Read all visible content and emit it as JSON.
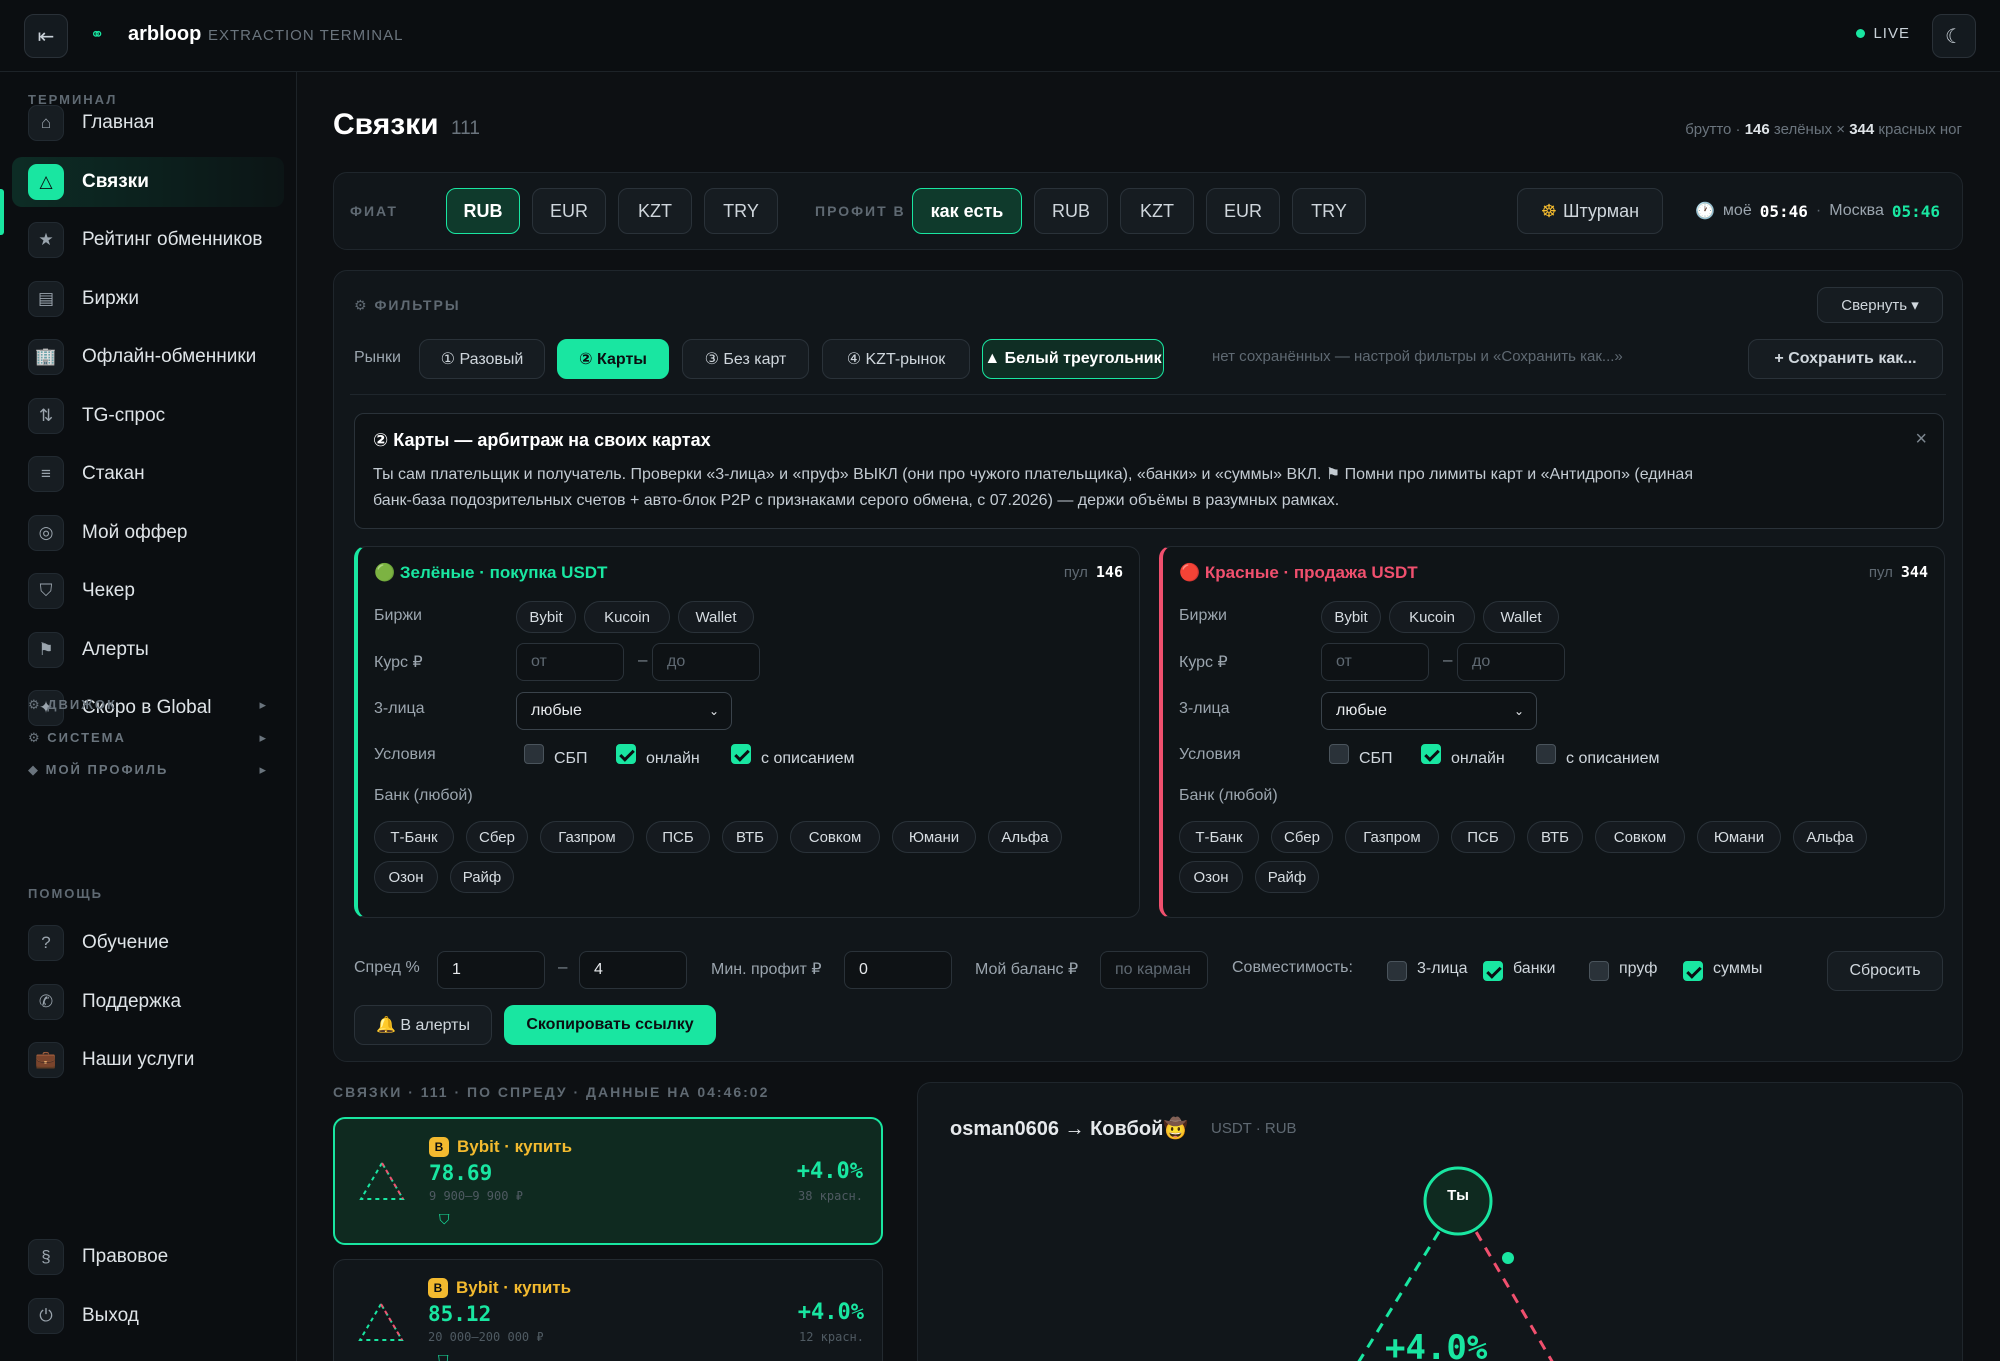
{
  "topbar": {
    "back_icon": "collapse-left-icon",
    "brand": "arbloop",
    "subtitle": "EXTRACTION TERMINAL",
    "live": "LIVE",
    "live_color": "#19e6a1",
    "theme_icon": "moon-icon"
  },
  "sidebar": {
    "section_terminal": "ТЕРМИНАЛ",
    "items": [
      {
        "label": "Главная",
        "icon": "home-icon",
        "glyph": "⌂"
      },
      {
        "label": "Связки",
        "icon": "triangle-icon",
        "glyph": "△"
      },
      {
        "label": "Рейтинг обменников",
        "icon": "star-icon",
        "glyph": "★"
      },
      {
        "label": "Биржи",
        "icon": "exchange-icon",
        "glyph": "▤"
      },
      {
        "label": "Офлайн-обменники",
        "icon": "building-icon",
        "glyph": "🏢"
      },
      {
        "label": "TG-спрос",
        "icon": "arrows-icon",
        "glyph": "⇅"
      },
      {
        "label": "Стакан",
        "icon": "orderbook-icon",
        "glyph": "≡"
      },
      {
        "label": "Мой оффер",
        "icon": "target-icon",
        "glyph": "◎"
      },
      {
        "label": "Чекер",
        "icon": "shield-icon",
        "glyph": "⛉"
      },
      {
        "label": "Алерты",
        "icon": "flag-icon",
        "glyph": "⚑"
      },
      {
        "label": "Скоро в Global",
        "icon": "sparkle-icon",
        "glyph": "✦"
      }
    ],
    "groups": [
      {
        "label": "⚙ ДВИЖОК",
        "arrow": "▸"
      },
      {
        "label": "⚙ СИСТЕМА",
        "arrow": "▸"
      },
      {
        "label": "◆ МОЙ ПРОФИЛЬ",
        "arrow": "▸"
      }
    ],
    "section_help": "ПОМОЩЬ",
    "help_items": [
      {
        "label": "Обучение",
        "icon": "question-icon",
        "glyph": "?"
      },
      {
        "label": "Поддержка",
        "icon": "phone-icon",
        "glyph": "✆"
      },
      {
        "label": "Наши услуги",
        "icon": "briefcase-icon",
        "glyph": "💼"
      }
    ],
    "bottom_items": [
      {
        "label": "Правовое",
        "icon": "section-icon",
        "glyph": "§"
      },
      {
        "label": "Выход",
        "icon": "power-icon",
        "glyph": "⏻"
      }
    ]
  },
  "page": {
    "title": "Связки",
    "count": "111",
    "stats_prefix": "брутто ·",
    "stats_green": "146",
    "stats_mid": "зелёных ×",
    "stats_red": "344",
    "stats_suffix": "красных ног"
  },
  "fiat_bar": {
    "fiat_label": "ФИАТ",
    "fiat_options": [
      "RUB",
      "EUR",
      "KZT",
      "TRY"
    ],
    "fiat_selected": "RUB",
    "profit_label": "ПРОФИТ В",
    "profit_options": [
      "как есть",
      "RUB",
      "KZT",
      "EUR",
      "TRY"
    ],
    "profit_selected": "как есть",
    "helmsman_label": "Штурман",
    "helmsman_icon": "helm-icon",
    "clock_icon": "clock-icon",
    "my_time_label": "моё",
    "my_time": "05:46",
    "moscow_label": "Москва",
    "moscow_time": "05:46"
  },
  "filters": {
    "title": "⚙ ФИЛЬТРЫ",
    "collapse_label": "Свернуть ▾",
    "markets_label": "Рынки",
    "markets": [
      {
        "label": "① Разовый",
        "state": "off"
      },
      {
        "label": "② Карты",
        "state": "solid"
      },
      {
        "label": "③ Без карт",
        "state": "off"
      },
      {
        "label": "④ KZT-рынок",
        "state": "off"
      },
      {
        "label": "▲ Белый треугольник",
        "state": "on"
      }
    ],
    "saved_hint": "нет сохранённых — настрой фильтры и «Сохранить как...»",
    "save_as_label": "+ Сохранить как...",
    "info": {
      "title": "② Карты — арбитраж на своих картах",
      "line1": "Ты сам плательщик и получатель. Проверки «3-лица» и «пруф» ВЫКЛ (они про чужого плательщика), «банки» и «суммы» ВКЛ. ⚑ Помни про лимиты карт и «Антидроп» (единая",
      "line2": "банк-база подозрительных счетов + авто-блок P2P с признаками серого обмена, с 07.2026) — держи объёмы в разумных рамках.",
      "close": "×"
    },
    "green": {
      "title": "🟢 Зелёные · покупка USDT",
      "pool_label": "пул",
      "pool": "146",
      "exchanges_label": "Биржи",
      "exchanges": [
        "Bybit",
        "Kucoin",
        "Wallet"
      ],
      "rate_label": "Курс ₽",
      "rate_from": "от",
      "rate_to": "до",
      "third_label": "3-лица",
      "third_value": "любые",
      "cond_label": "Условия",
      "conds": [
        {
          "label": "СБП",
          "checked": false
        },
        {
          "label": "онлайн",
          "checked": true
        },
        {
          "label": "с описанием",
          "checked": true
        }
      ],
      "bank_label": "Банк (любой)",
      "banks": [
        "Т-Банк",
        "Сбер",
        "Газпром",
        "ПСБ",
        "ВТБ",
        "Совком",
        "Юмани",
        "Альфа",
        "Озон",
        "Райф"
      ]
    },
    "red": {
      "title": "🔴 Красные · продажа USDT",
      "pool_label": "пул",
      "pool": "344",
      "exchanges_label": "Биржи",
      "exchanges": [
        "Bybit",
        "Kucoin",
        "Wallet"
      ],
      "rate_label": "Курс ₽",
      "rate_from": "от",
      "rate_to": "до",
      "third_label": "3-лица",
      "third_value": "любые",
      "cond_label": "Условия",
      "conds": [
        {
          "label": "СБП",
          "checked": false
        },
        {
          "label": "онлайн",
          "checked": true
        },
        {
          "label": "с описанием",
          "checked": false
        }
      ],
      "bank_label": "Банк (любой)",
      "banks": [
        "Т-Банк",
        "Сбер",
        "Газпром",
        "ПСБ",
        "ВТБ",
        "Совком",
        "Юмани",
        "Альфа",
        "Озон",
        "Райф"
      ]
    },
    "spread_label": "Спред %",
    "spread_from": "1",
    "spread_dash": "–",
    "spread_to": "4",
    "minprofit_label": "Мин. профит ₽",
    "minprofit": "0",
    "balance_label": "Мой баланс ₽",
    "balance_placeholder": "по карман",
    "compat_label": "Совместимость:",
    "compat": [
      {
        "label": "3-лица",
        "checked": false
      },
      {
        "label": "банки",
        "checked": true
      },
      {
        "label": "пруф",
        "checked": false
      },
      {
        "label": "суммы",
        "checked": true
      }
    ],
    "reset_label": "Сбросить",
    "alerts_label": "🔔 В алерты",
    "copy_link_label": "Скопировать ссылку"
  },
  "deals": {
    "header": "СВЯЗКИ · 111 · ПО СПРЕДУ · ДАННЫЕ НА 04:46:02",
    "items": [
      {
        "badge": "B",
        "title": "Bybit · купить",
        "price": "78.69",
        "range": "9 900–9 900 ₽",
        "profit": "+4.0%",
        "red_count": "38 красн."
      },
      {
        "badge": "B",
        "title": "Bybit · купить",
        "price": "85.12",
        "range": "20 000–200 000 ₽",
        "profit": "+4.0%",
        "red_count": "12 красн."
      }
    ]
  },
  "detail": {
    "title": "osman0606 → Ковбой🤠",
    "pair": "USDT · RUB",
    "node_label": "Ты",
    "profit": "+4.0%"
  },
  "colors": {
    "accent": "#19e6a1",
    "red": "#f0506e",
    "bg": "#0d1013",
    "panel": "#11161a"
  }
}
